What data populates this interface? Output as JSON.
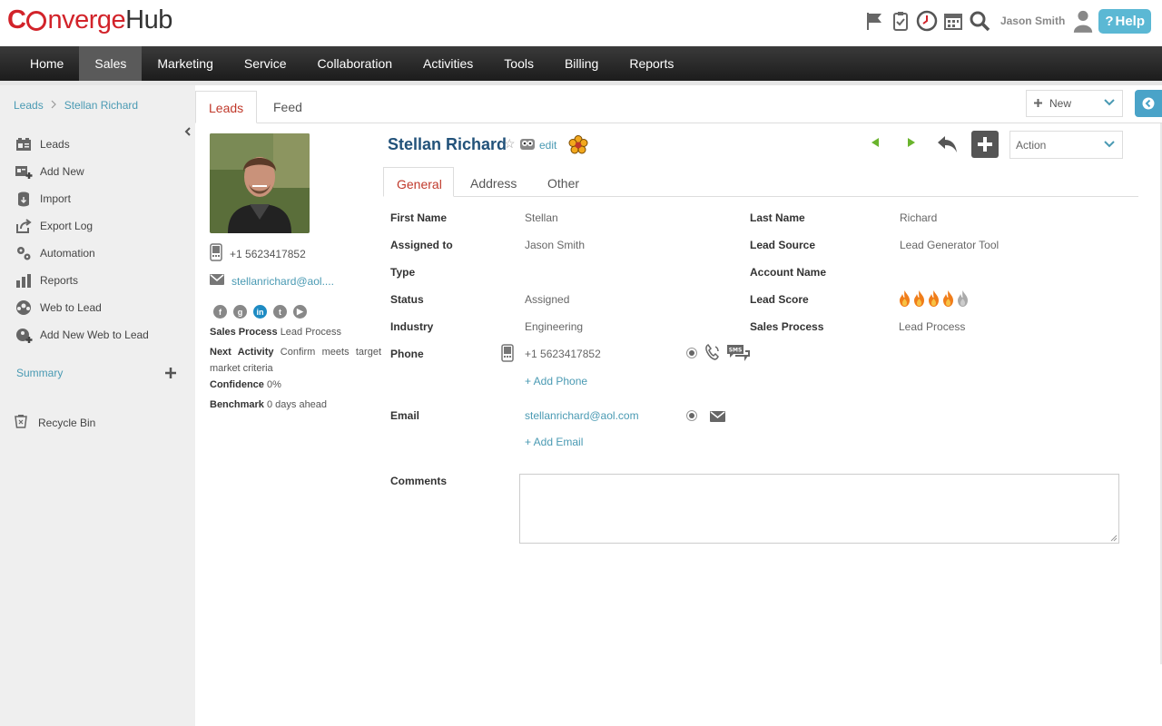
{
  "app": {
    "logo_c": "C",
    "logo_mid": "nverge",
    "logo_hub": "Hub"
  },
  "header": {
    "username": "Jason Smith",
    "help_label": "Help",
    "help_q": "?"
  },
  "nav": {
    "items": [
      {
        "label": "Home"
      },
      {
        "label": "Sales"
      },
      {
        "label": "Marketing"
      },
      {
        "label": "Service"
      },
      {
        "label": "Collaboration"
      },
      {
        "label": "Activities"
      },
      {
        "label": "Tools"
      },
      {
        "label": "Billing"
      },
      {
        "label": "Reports"
      }
    ],
    "active": "Sales"
  },
  "breadcrumb": {
    "root": "Leads",
    "sep": ">",
    "current": "Stellan Richard"
  },
  "sidebar": {
    "items": [
      {
        "label": "Leads",
        "icon": "leads-icon"
      },
      {
        "label": "Add New",
        "icon": "add-new-icon"
      },
      {
        "label": "Import",
        "icon": "import-icon"
      },
      {
        "label": "Export Log",
        "icon": "export-icon"
      },
      {
        "label": "Automation",
        "icon": "gears-icon"
      },
      {
        "label": "Reports",
        "icon": "bar-chart-icon"
      },
      {
        "label": "Web to Lead",
        "icon": "web-lead-icon"
      },
      {
        "label": "Add New Web to Lead",
        "icon": "add-web-lead-icon"
      }
    ],
    "summary": "Summary",
    "recycle": "Recycle Bin"
  },
  "tabs": {
    "leads": "Leads",
    "feed": "Feed",
    "new_label": "New"
  },
  "profile": {
    "phone": "+1 5623417852",
    "email": "stellanrichard@aol....",
    "sales_process_label": "Sales Process",
    "sales_process_value": "Lead Process",
    "next_activity_label": "Next Activity",
    "next_activity_value": "Confirm meets target market criteria",
    "confidence_label": "Confidence",
    "confidence_value": "0%",
    "benchmark_label": "Benchmark",
    "benchmark_value": "0 days ahead"
  },
  "record": {
    "name": "Stellan Richard",
    "edit": "edit",
    "action_label": "Action",
    "tabs": [
      "General",
      "Address",
      "Other"
    ],
    "fields": {
      "first_name_label": "First Name",
      "first_name": "Stellan",
      "last_name_label": "Last Name",
      "last_name": "Richard",
      "assigned_label": "Assigned to",
      "assigned": "Jason Smith",
      "lead_source_label": "Lead Source",
      "lead_source": "Lead Generator Tool",
      "type_label": "Type",
      "account_label": "Account Name",
      "status_label": "Status",
      "status": "Assigned",
      "lead_score_label": "Lead Score",
      "lead_score": 4,
      "lead_score_max": 5,
      "industry_label": "Industry",
      "industry": "Engineering",
      "sales_process_label": "Sales Process",
      "sales_process": "Lead Process",
      "phone_label": "Phone",
      "phone": "+1 5623417852",
      "add_phone": "+ Add Phone",
      "email_label": "Email",
      "email": "stellanrichard@aol.com",
      "add_email": "+ Add Email",
      "comments_label": "Comments",
      "sms": "SMS"
    }
  },
  "colors": {
    "brand_red": "#d2232a",
    "link": "#4a9ab3",
    "name_blue": "#22527a",
    "help": "#5bb8d4",
    "arrow_green": "#6ab42d",
    "flame": "#f07d1a"
  }
}
